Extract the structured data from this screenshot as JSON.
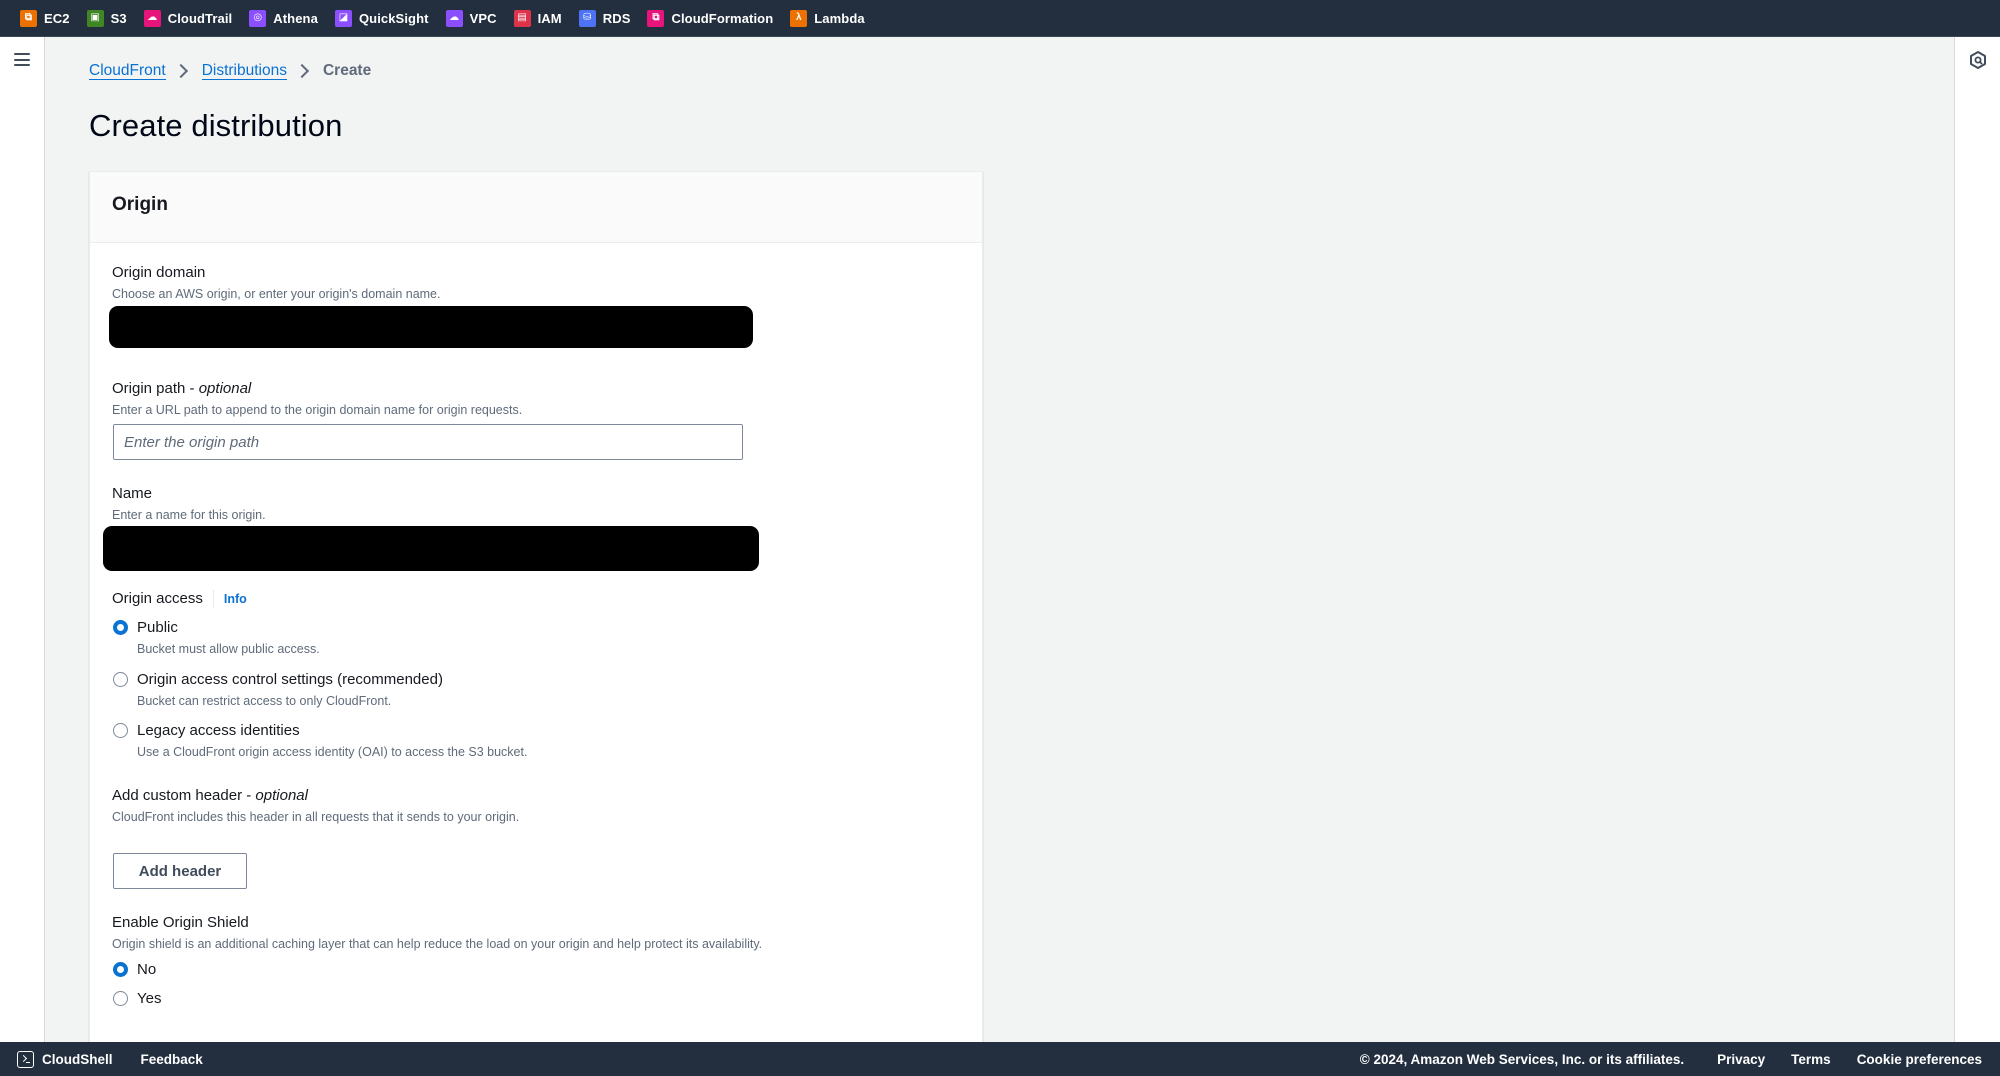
{
  "topbar": {
    "services": [
      {
        "label": "EC2",
        "icon": "ec2-icon",
        "color": "#ed7100",
        "glyph": "⧉"
      },
      {
        "label": "S3",
        "icon": "s3-icon",
        "color": "#3f8624",
        "glyph": "▣"
      },
      {
        "label": "CloudTrail",
        "icon": "cloudtrail-icon",
        "color": "#e7157b",
        "glyph": "☁"
      },
      {
        "label": "Athena",
        "icon": "athena-icon",
        "color": "#8c4fff",
        "glyph": "◎"
      },
      {
        "label": "QuickSight",
        "icon": "quicksight-icon",
        "color": "#8c4fff",
        "glyph": "◪"
      },
      {
        "label": "VPC",
        "icon": "vpc-icon",
        "color": "#8c4fff",
        "glyph": "☁"
      },
      {
        "label": "IAM",
        "icon": "iam-icon",
        "color": "#dd344c",
        "glyph": "▤"
      },
      {
        "label": "RDS",
        "icon": "rds-icon",
        "color": "#4d72f3",
        "glyph": "⛁"
      },
      {
        "label": "CloudFormation",
        "icon": "cloudformation-icon",
        "color": "#e7157b",
        "glyph": "⧉"
      },
      {
        "label": "Lambda",
        "icon": "lambda-icon",
        "color": "#ed7100",
        "glyph": "λ"
      }
    ]
  },
  "breadcrumb": {
    "items": [
      "CloudFront",
      "Distributions"
    ],
    "current": "Create"
  },
  "page": {
    "title": "Create distribution"
  },
  "origin_card": {
    "title": "Origin",
    "origin_domain": {
      "label": "Origin domain",
      "description": "Choose an AWS origin, or enter your origin's domain name."
    },
    "origin_path": {
      "label": "Origin path - ",
      "label_optional": "optional",
      "description": "Enter a URL path to append to the origin domain name for origin requests.",
      "placeholder": "Enter the origin path",
      "value": ""
    },
    "name": {
      "label": "Name",
      "description": "Enter a name for this origin."
    },
    "origin_access": {
      "label": "Origin access",
      "info": "Info",
      "selected": "Public",
      "options": [
        {
          "label": "Public",
          "description": "Bucket must allow public access.",
          "checked": true
        },
        {
          "label": "Origin access control settings (recommended)",
          "description": "Bucket can restrict access to only CloudFront.",
          "checked": false
        },
        {
          "label": "Legacy access identities",
          "description": "Use a CloudFront origin access identity (OAI) to access the S3 bucket.",
          "checked": false
        }
      ]
    },
    "custom_header": {
      "label": "Add custom header - ",
      "label_optional": "optional",
      "description": "CloudFront includes this header in all requests that it sends to your origin.",
      "button": "Add header"
    },
    "origin_shield": {
      "label": "Enable Origin Shield",
      "description": "Origin shield is an additional caching layer that can help reduce the load on your origin and help protect its availability.",
      "selected": "No",
      "options": [
        {
          "label": "No",
          "checked": true
        },
        {
          "label": "Yes",
          "checked": false
        }
      ]
    }
  },
  "footer": {
    "cloudshell": "CloudShell",
    "feedback": "Feedback",
    "copyright": "© 2024, Amazon Web Services, Inc. or its affiliates.",
    "links": [
      "Privacy",
      "Terms",
      "Cookie preferences"
    ]
  },
  "colors": {
    "accent": "#0972d3",
    "nav_bg": "#232f3e",
    "page_bg": "#f2f3f3"
  }
}
